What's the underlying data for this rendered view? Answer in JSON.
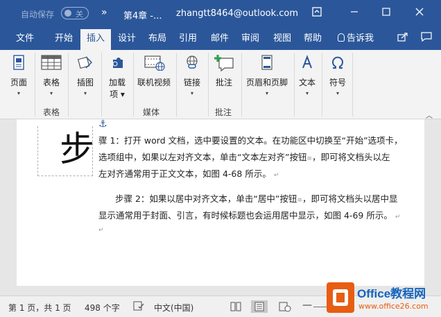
{
  "titlebar": {
    "autosave_label": "自动保存",
    "autosave_state": "关",
    "qa_arrow": "»",
    "doc_title": "第4章 -...",
    "user": "zhangtt8464@outlook.com"
  },
  "tabs": [
    "文件",
    "开始",
    "插入",
    "设计",
    "布局",
    "引用",
    "邮件",
    "审阅",
    "视图",
    "帮助"
  ],
  "tellme": "告诉我",
  "ribbon": {
    "page": "页面",
    "table": "表格",
    "illustrations": "插图",
    "addins_line1": "加载",
    "addins_line2": "项",
    "online_video": "联机视频",
    "links": "链接",
    "comment": "批注",
    "header_footer": "页眉和页脚",
    "text": "文本",
    "symbols": "符号",
    "group_table": "表格",
    "group_media": "媒体",
    "group_comments": "批注"
  },
  "document": {
    "dropcap": "步",
    "p1_line1": "骤 1：打开 word 文档，选中要设置的文本。在功能区中切换至“开始”选项卡，",
    "p1_line2": "选项组中，如果以左对齐文本，单击“文本左对齐”按钮",
    "p1_line2_end": "，即可将文档头以左",
    "p1_line3": "左对齐通常用于正文文本，如图 4-68 所示。",
    "p2_line1": "步骤 2：如果以居中对齐文本，单击“居中”按钮",
    "p2_line1_end": "，即可将文档头以居中显",
    "p2_line2": "显示通常用于封面、引言，有时候标题也会运用居中显示，如图 4-69 所示。",
    "para_mark": "↵",
    "btn_glyph": "≡"
  },
  "statusbar": {
    "page_info": "第 1 页，共 1 页",
    "word_count": "498 个字",
    "language": "中文(中国)"
  },
  "watermark": {
    "brand": "Office教程网",
    "url": "www.office26.com"
  }
}
